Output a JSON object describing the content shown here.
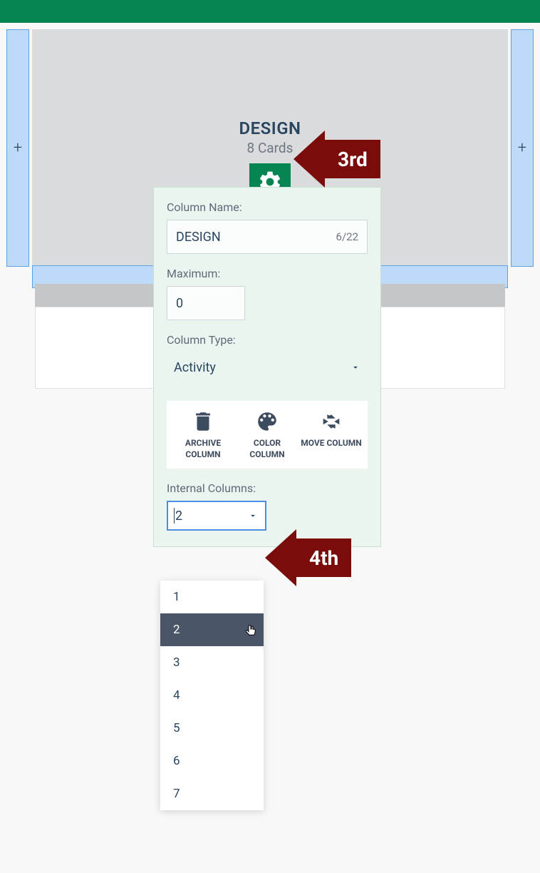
{
  "column": {
    "title": "DESIGN",
    "cards_label": "8 Cards"
  },
  "panel": {
    "name_label": "Column Name:",
    "name_value": "DESIGN",
    "name_counter": "6/22",
    "max_label": "Maximum:",
    "max_value": "0",
    "type_label": "Column Type:",
    "type_value": "Activity",
    "actions": {
      "archive": "ARCHIVE COLUMN",
      "color": "COLOR COLUMN",
      "move": "MOVE COLUMN"
    },
    "internal_label": "Internal Columns:",
    "internal_value": "2"
  },
  "dropdown": {
    "options": [
      "1",
      "2",
      "3",
      "4",
      "5",
      "6",
      "7"
    ],
    "hover_index": 1
  },
  "annotations": {
    "third": "3rd",
    "fourth": "4th"
  },
  "plus": "+"
}
